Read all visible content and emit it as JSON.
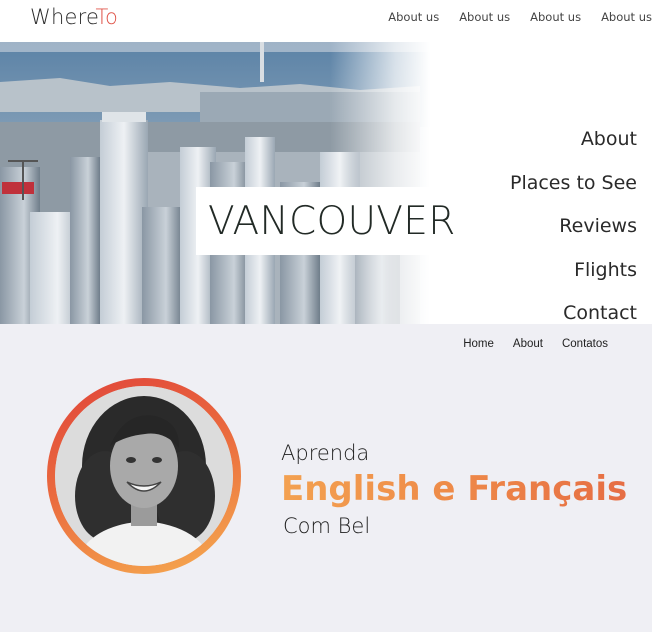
{
  "header": {
    "logo_part1": "Where",
    "logo_part2": "To",
    "nav": [
      "About us",
      "About us",
      "About us",
      "About us"
    ]
  },
  "hero": {
    "city": "VANCOUVER",
    "menu": [
      "About",
      "Places to See",
      "Reviews",
      "Flights",
      "Contact"
    ]
  },
  "section2": {
    "nav": [
      "Home",
      "About",
      "Contatos"
    ],
    "line1": "Aprenda",
    "line2": "English e Français",
    "line3": "Com Bel"
  },
  "colors": {
    "logo_accent": "#e0564b",
    "gradient_start": "#e0443a",
    "gradient_end": "#f6ad50",
    "section_bg": "#efeff4"
  }
}
